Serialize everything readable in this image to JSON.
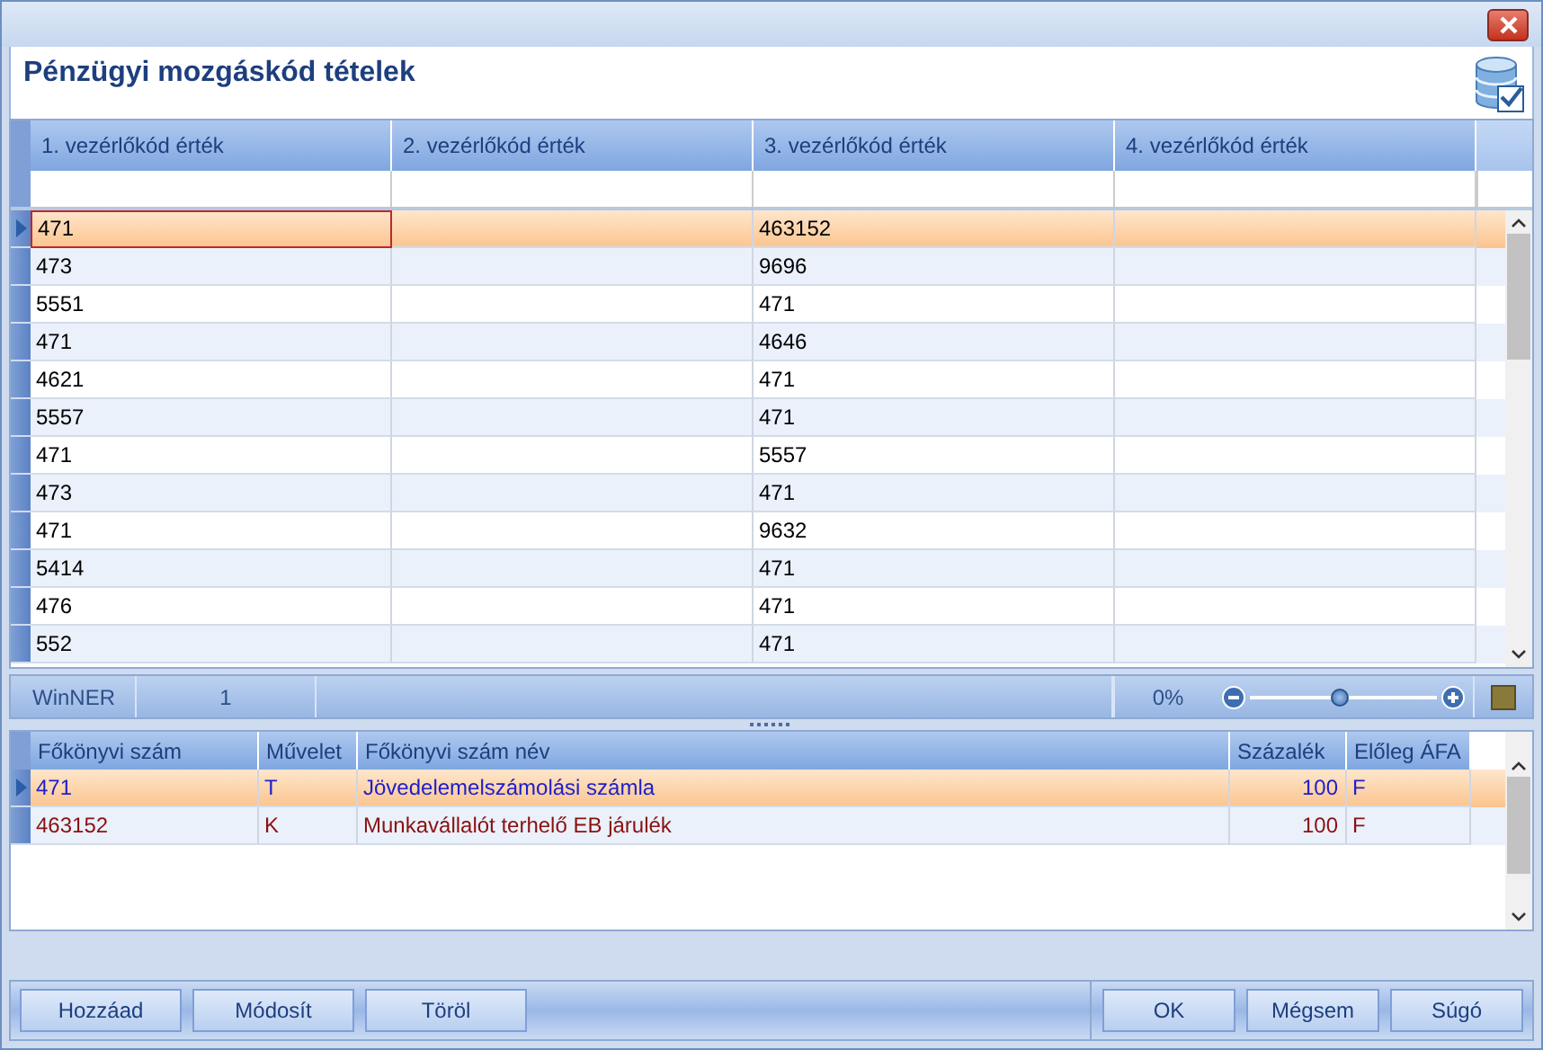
{
  "window": {
    "title": "Pénzügyi mozgáskód tételek"
  },
  "upper_grid": {
    "columns": [
      "1. vezérlőkód érték",
      "2. vezérlőkód érték",
      "3. vezérlőkód érték",
      "4. vezérlőkód érték"
    ],
    "rows": [
      {
        "selected": true,
        "first_cell_focused": true,
        "cells": [
          "471",
          null,
          "463152",
          null
        ]
      },
      {
        "selected": false,
        "first_cell_focused": false,
        "cells": [
          "473",
          null,
          "9696",
          null
        ]
      },
      {
        "selected": false,
        "first_cell_focused": false,
        "cells": [
          "5551",
          null,
          "471",
          null
        ]
      },
      {
        "selected": false,
        "first_cell_focused": false,
        "cells": [
          "471",
          null,
          "4646",
          null
        ]
      },
      {
        "selected": false,
        "first_cell_focused": false,
        "cells": [
          "4621",
          null,
          "471",
          null
        ]
      },
      {
        "selected": false,
        "first_cell_focused": false,
        "cells": [
          "5557",
          null,
          "471",
          null
        ]
      },
      {
        "selected": false,
        "first_cell_focused": false,
        "cells": [
          "471",
          null,
          "5557",
          null
        ]
      },
      {
        "selected": false,
        "first_cell_focused": false,
        "cells": [
          "473",
          null,
          "471",
          null
        ]
      },
      {
        "selected": false,
        "first_cell_focused": false,
        "cells": [
          "471",
          null,
          "9632",
          null
        ]
      },
      {
        "selected": false,
        "first_cell_focused": false,
        "cells": [
          "5414",
          null,
          "471",
          null
        ]
      },
      {
        "selected": false,
        "first_cell_focused": false,
        "cells": [
          "476",
          null,
          "471",
          null
        ]
      },
      {
        "selected": false,
        "first_cell_focused": false,
        "cells": [
          "552",
          null,
          "471",
          null
        ]
      }
    ]
  },
  "status_bar": {
    "app": "WinNER",
    "count": "1",
    "zoom": "0%",
    "zoom_slider": {
      "level": 0.48
    }
  },
  "lower_grid": {
    "columns": [
      "Főkönyvi szám",
      "Művelet",
      "Főkönyvi szám név",
      "Százalék",
      "Előleg ÁFA"
    ],
    "rows": [
      {
        "selected": true,
        "cells": [
          "471",
          "T",
          "Jövedelemelszámolási számla",
          "100",
          "F"
        ]
      },
      {
        "selected": false,
        "cells": [
          "463152",
          "K",
          "Munkavállalót terhelő EB járulék",
          "100",
          "F"
        ]
      }
    ]
  },
  "left_buttons": [
    "Hozzáad",
    "Módosít",
    "Töröl"
  ],
  "right_buttons": [
    "OK",
    "Mégsem",
    "Súgó"
  ]
}
